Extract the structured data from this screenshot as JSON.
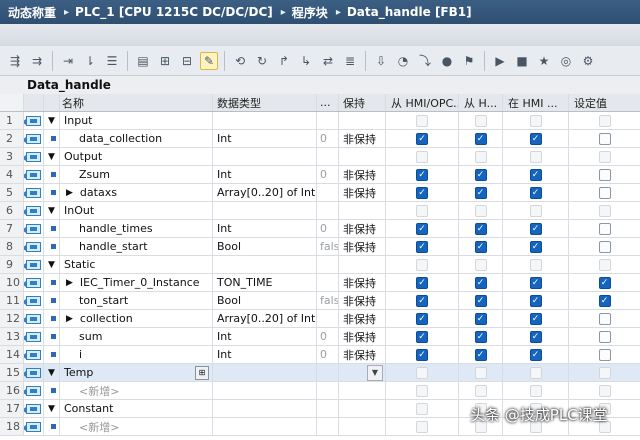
{
  "breadcrumb": [
    "动态称重",
    "PLC_1 [CPU 1215C DC/DC/DC]",
    "程序块",
    "Data_handle [FB1]"
  ],
  "breadcrumb_sep": "▸",
  "block_name": "Data_handle",
  "toolbar_icons": [
    "insert-row-icon",
    "add-row-icon",
    "move-icon",
    "cut-icon",
    "list-icon",
    "monitor-icon",
    "expand-icon",
    "collapse-icon",
    "highlight-icon",
    "network-icon",
    "branch-icon",
    "open-branch-icon",
    "close-branch-icon",
    "jump-icon",
    "compare-icon",
    "download-icon",
    "watch-icon",
    "step-icon",
    "breakpoint-icon",
    "force-icon",
    "go-icon",
    "stop-icon",
    "favorite-icon",
    "glasses-icon",
    "settings-icon"
  ],
  "columns": {
    "name": "名称",
    "type": "数据类型",
    "default": "...",
    "retain": "保持",
    "hmi1": "从 HMI/OPC...",
    "hmi2": "从 H...",
    "hmi3": "在 HMI ...",
    "setpoint": "设定值"
  },
  "rows": [
    {
      "num": "1",
      "kind": "section",
      "name": "Input",
      "type": "",
      "default": "",
      "retain": "",
      "c": [
        0,
        0,
        0,
        0
      ]
    },
    {
      "num": "2",
      "kind": "var",
      "name": "data_collection",
      "type": "Int",
      "default": "0",
      "retain": "非保持",
      "c": [
        1,
        1,
        1,
        -1
      ]
    },
    {
      "num": "3",
      "kind": "section",
      "name": "Output",
      "type": "",
      "default": "",
      "retain": "",
      "c": [
        0,
        0,
        0,
        0
      ]
    },
    {
      "num": "4",
      "kind": "var",
      "name": "Zsum",
      "type": "Int",
      "default": "0",
      "retain": "非保持",
      "c": [
        1,
        1,
        1,
        -1
      ]
    },
    {
      "num": "5",
      "kind": "struct",
      "name": "dataxs",
      "type": "Array[0..20] of Int",
      "default": "",
      "retain": "非保持",
      "c": [
        1,
        1,
        1,
        -1
      ]
    },
    {
      "num": "6",
      "kind": "section",
      "name": "InOut",
      "type": "",
      "default": "",
      "retain": "",
      "c": [
        0,
        0,
        0,
        0
      ]
    },
    {
      "num": "7",
      "kind": "var",
      "name": "handle_times",
      "type": "Int",
      "default": "0",
      "retain": "非保持",
      "c": [
        1,
        1,
        1,
        -1
      ]
    },
    {
      "num": "8",
      "kind": "var",
      "name": "handle_start",
      "type": "Bool",
      "default": "fals",
      "retain": "非保持",
      "c": [
        1,
        1,
        1,
        -1
      ]
    },
    {
      "num": "9",
      "kind": "section",
      "name": "Static",
      "type": "",
      "default": "",
      "retain": "",
      "c": [
        0,
        0,
        0,
        0
      ]
    },
    {
      "num": "10",
      "kind": "struct",
      "name": "IEC_Timer_0_Instance",
      "type": "TON_TIME",
      "default": "",
      "retain": "非保持",
      "c": [
        1,
        1,
        1,
        1
      ]
    },
    {
      "num": "11",
      "kind": "var",
      "name": "ton_start",
      "type": "Bool",
      "default": "fals",
      "retain": "非保持",
      "c": [
        1,
        1,
        1,
        1
      ]
    },
    {
      "num": "12",
      "kind": "struct",
      "name": "collection",
      "type": "Array[0..20] of Int",
      "default": "",
      "retain": "非保持",
      "c": [
        1,
        1,
        1,
        -1
      ]
    },
    {
      "num": "13",
      "kind": "var",
      "name": "sum",
      "type": "Int",
      "default": "0",
      "retain": "非保持",
      "c": [
        1,
        1,
        1,
        -1
      ]
    },
    {
      "num": "14",
      "kind": "var",
      "name": "i",
      "type": "Int",
      "default": "0",
      "retain": "非保持",
      "c": [
        1,
        1,
        1,
        -1
      ]
    },
    {
      "num": "15",
      "kind": "section",
      "name": "Temp",
      "type": "",
      "default": "",
      "retain": "",
      "c": [
        0,
        0,
        0,
        0
      ],
      "selected": true
    },
    {
      "num": "16",
      "kind": "new",
      "name": "<新增>",
      "type": "",
      "default": "",
      "retain": "",
      "c": [
        0,
        0,
        0,
        0
      ]
    },
    {
      "num": "17",
      "kind": "section",
      "name": "Constant",
      "type": "",
      "default": "",
      "retain": "",
      "c": [
        0,
        0,
        0,
        0
      ]
    },
    {
      "num": "18",
      "kind": "new",
      "name": "<新增>",
      "type": "",
      "default": "",
      "retain": "",
      "c": [
        0,
        0,
        0,
        0
      ]
    }
  ],
  "watermark": "头条 @技成PLC课堂",
  "colors": {
    "checkbox_on": "#1565c0",
    "titlebar": "#35597e",
    "icon_blue": "#2f7fc1"
  }
}
